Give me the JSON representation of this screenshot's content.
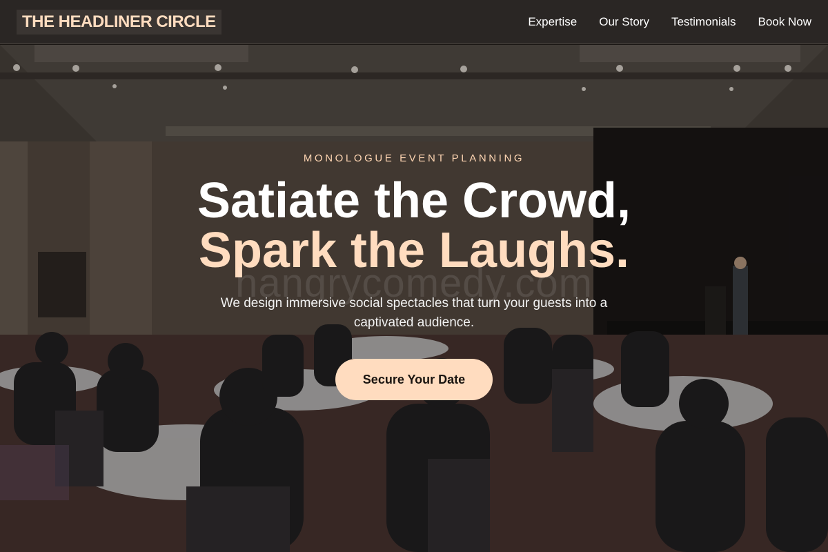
{
  "header": {
    "logo": "THE HEADLINER CIRCLE",
    "nav": [
      "Expertise",
      "Our Story",
      "Testimonials",
      "Book Now"
    ]
  },
  "hero": {
    "eyebrow": "MONOLOGUE EVENT PLANNING",
    "headline_line1": "Satiate the Crowd,",
    "headline_line2": "Spark the Laughs.",
    "watermark": "hangrycomedy.com",
    "subtitle": "We design immersive social spectacles that turn your guests into a captivated audience.",
    "cta_label": "Secure Your Date"
  },
  "colors": {
    "accent": "#ffdcbf",
    "header_bg": "#2a2624",
    "cta_text": "#1a1410"
  }
}
